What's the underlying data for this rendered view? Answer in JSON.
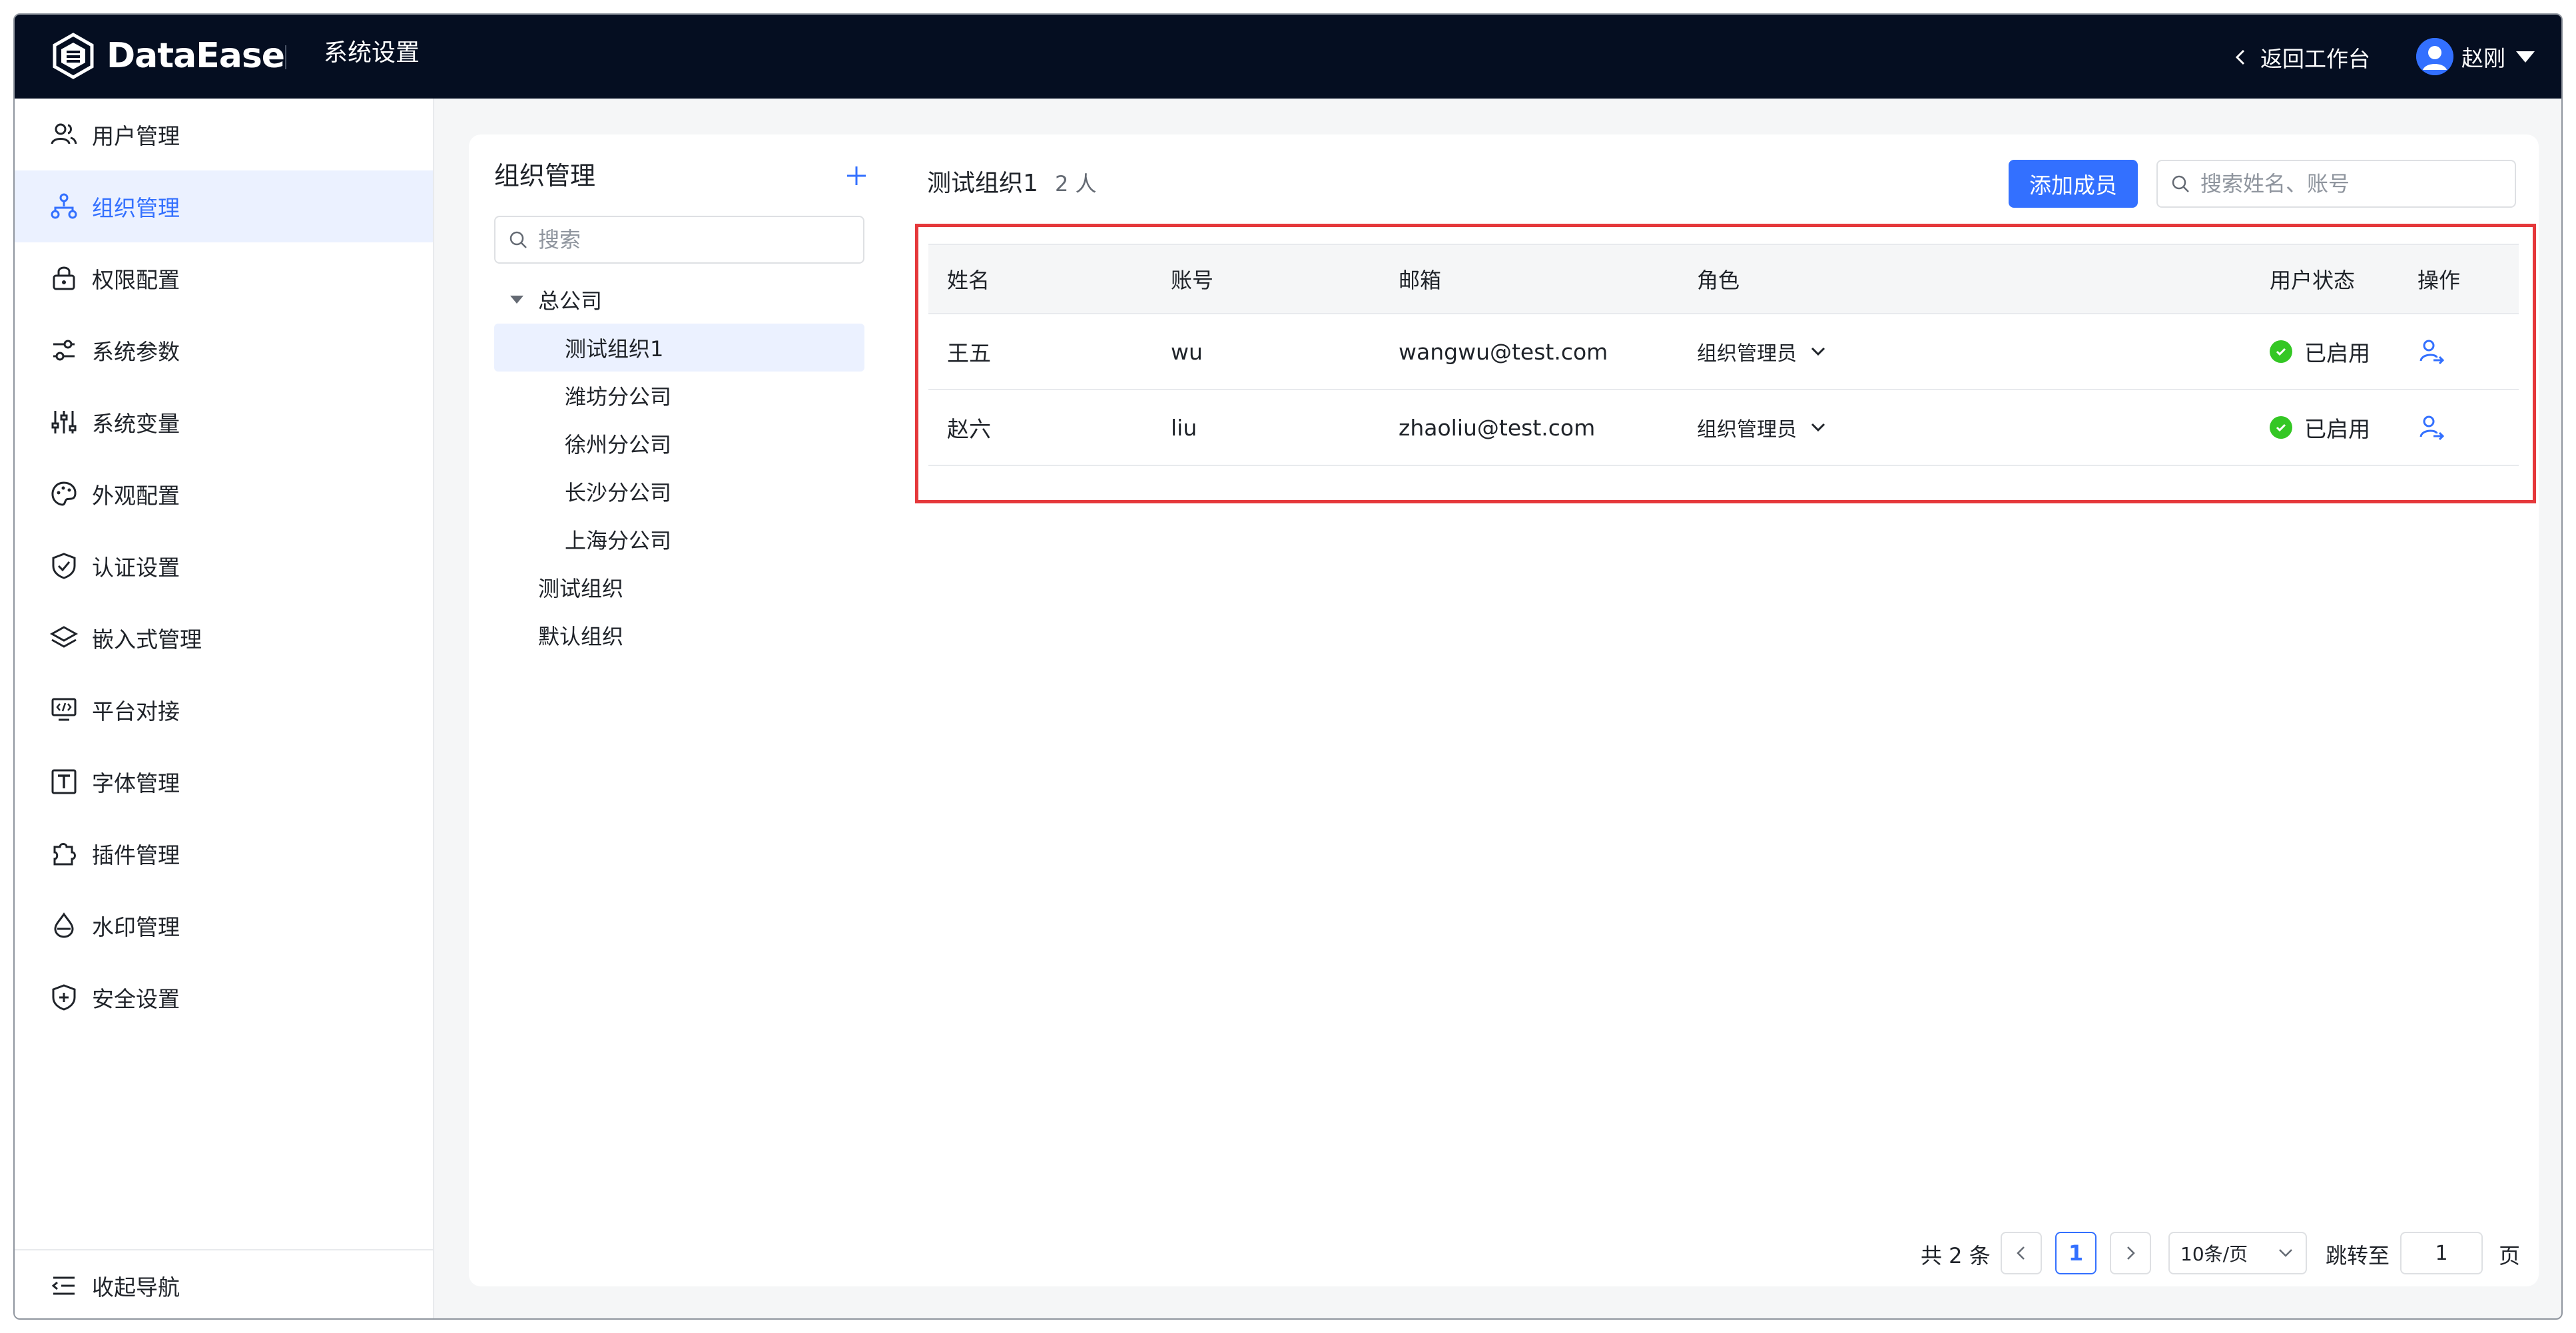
{
  "app": {
    "logo_text": "DataEase",
    "section_title": "系统设置",
    "back_label": "返回工作台",
    "user_name": "赵刚"
  },
  "sidebar": {
    "items": [
      {
        "label": "用户管理",
        "icon": "users-icon"
      },
      {
        "label": "组织管理",
        "icon": "org-tree-icon",
        "active": true
      },
      {
        "label": "权限配置",
        "icon": "lock-icon"
      },
      {
        "label": "系统参数",
        "icon": "sliders-icon"
      },
      {
        "label": "系统变量",
        "icon": "variables-icon"
      },
      {
        "label": "外观配置",
        "icon": "palette-icon"
      },
      {
        "label": "认证设置",
        "icon": "shield-check-icon"
      },
      {
        "label": "嵌入式管理",
        "icon": "layers-icon"
      },
      {
        "label": "平台对接",
        "icon": "monitor-code-icon"
      },
      {
        "label": "字体管理",
        "icon": "font-icon"
      },
      {
        "label": "插件管理",
        "icon": "puzzle-icon"
      },
      {
        "label": "水印管理",
        "icon": "drop-icon"
      },
      {
        "label": "安全设置",
        "icon": "shield-plus-icon"
      }
    ],
    "collapse_label": "收起导航"
  },
  "org_tree": {
    "title": "组织管理",
    "search_placeholder": "搜索",
    "nodes": [
      {
        "label": "总公司",
        "level": 0,
        "expanded": true
      },
      {
        "label": "测试组织1",
        "level": 1,
        "selected": true
      },
      {
        "label": "潍坊分公司",
        "level": 1
      },
      {
        "label": "徐州分公司",
        "level": 1
      },
      {
        "label": "长沙分公司",
        "level": 1
      },
      {
        "label": "上海分公司",
        "level": 1
      },
      {
        "label": "测试组织",
        "level": 0
      },
      {
        "label": "默认组织",
        "level": 0
      }
    ]
  },
  "members": {
    "org_name": "测试组织1",
    "count_label": "2 人",
    "add_button": "添加成员",
    "search_placeholder": "搜索姓名、账号",
    "columns": [
      "姓名",
      "账号",
      "邮箱",
      "角色",
      "用户状态",
      "操作"
    ],
    "rows": [
      {
        "name": "王五",
        "account": "wu",
        "email": "wangwu@test.com",
        "role": "组织管理员",
        "status": "已启用"
      },
      {
        "name": "赵六",
        "account": "liu",
        "email": "zhaoliu@test.com",
        "role": "组织管理员",
        "status": "已启用"
      }
    ],
    "status_color": "#34c724",
    "highlight_color": "#e5383b"
  },
  "pagination": {
    "total_label": "共 2 条",
    "current_page": "1",
    "page_size": "10条/页",
    "jump_label": "跳转至",
    "jump_value": "1",
    "page_suffix": "页"
  },
  "colors": {
    "accent": "#3370ff",
    "topbar": "#050e21"
  }
}
